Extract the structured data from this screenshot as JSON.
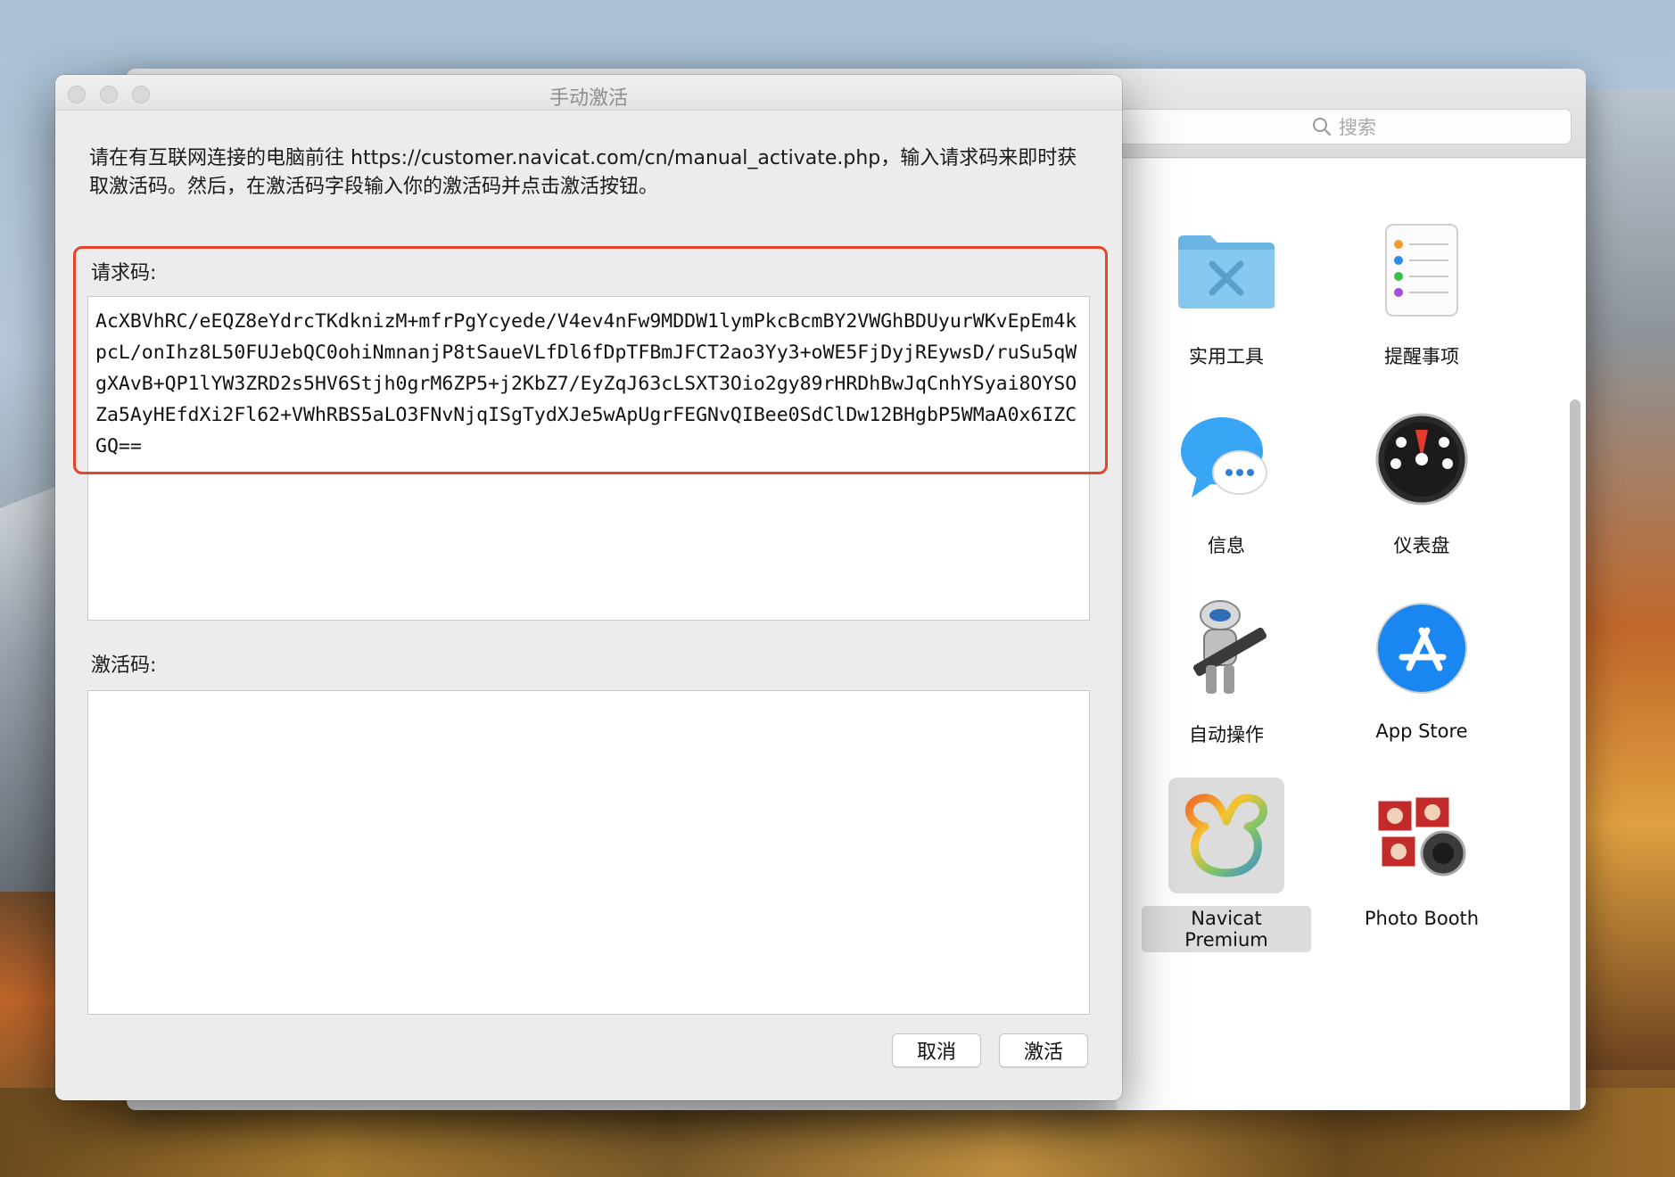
{
  "dialog": {
    "title": "手动激活",
    "instructions": "请在有互联网连接的电脑前往 https://customer.navicat.com/cn/manual_activate.php，输入请求码来即时获取激活码。然后，在激活码字段输入你的激活码并点击激活按钮。",
    "request_label": "请求码:",
    "request_code": "AcXBVhRC/eEQZ8eYdrcTKdknizM+mfrPgYcyede/V4ev4nFw9MDDW1lymPkcBcmBY2VWGhBDUyurWKvEpEm4kpcL/onIhz8L50FUJebQC0ohiNmnanjP8tSaueVLfDl6fDpTFBmJFCT2ao3Yy3+oWE5FjDyjREywsD/ruSu5qWgXAvB+QP1lYW3ZRD2s5HV6Stjh0grM6ZP5+j2KbZ7/EyZqJ63cLSXT3Oio2gy89rHRDhBwJqCnhYSyai8OYSOZa5AyHEfdXi2Fl62+VWhRBS5aLO3FNvNjqISgTydXJe5wApUgrFEGNvQIBee0SdClDw12BHgbP5WMaA0x6IZCGQ==",
    "activation_label": "激活码:",
    "activation_code": "",
    "cancel_label": "取消",
    "activate_label": "激活"
  },
  "finder": {
    "search_placeholder": "搜索",
    "apps": [
      {
        "label": "实用工具",
        "icon": "utilities-folder-icon"
      },
      {
        "label": "提醒事项",
        "icon": "reminders-icon"
      },
      {
        "label": "信息",
        "icon": "messages-icon"
      },
      {
        "label": "仪表盘",
        "icon": "dashboard-icon"
      },
      {
        "label": "自动操作",
        "icon": "automator-icon"
      },
      {
        "label": "App Store",
        "icon": "app-store-icon"
      },
      {
        "label": "Navicat Premium",
        "icon": "navicat-premium-icon",
        "selected": true
      },
      {
        "label": "Photo Booth",
        "icon": "photo-booth-icon"
      }
    ]
  },
  "colors": {
    "highlight": "#e5452b",
    "folder": "#7cc4ec",
    "app_store": "#1a86f2"
  }
}
